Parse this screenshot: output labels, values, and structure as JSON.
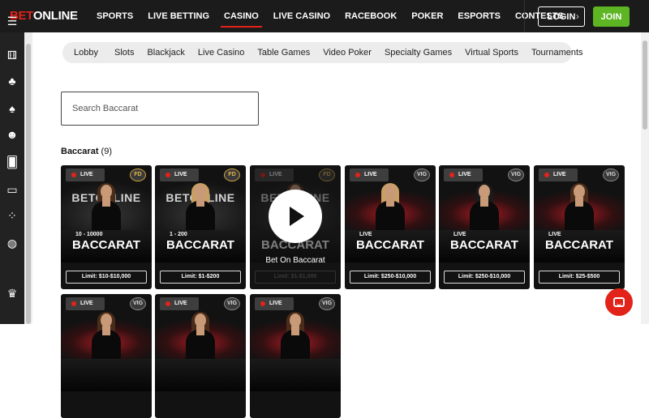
{
  "logo": {
    "part_red": "BET",
    "part_white": "ONLINE"
  },
  "nav": {
    "items": [
      "SPORTS",
      "LIVE BETTING",
      "CASINO",
      "LIVE CASINO",
      "RACEBOOK",
      "POKER",
      "ESPORTS",
      "CONTESTS"
    ],
    "active": "CASINO",
    "more_icon": "chevron-right-icon",
    "more_glyph": "›",
    "login_label": "LOGIN",
    "join_label": "JOIN"
  },
  "sidebar": {
    "icons": [
      {
        "name": "menu-icon",
        "glyph": "☰"
      },
      {
        "name": "dice-icon",
        "glyph": "⚅"
      },
      {
        "name": "cherries-icon",
        "glyph": "♣"
      },
      {
        "name": "spade-icon",
        "glyph": "♠"
      },
      {
        "name": "dealer-icon",
        "glyph": "☻"
      },
      {
        "name": "cards-icon",
        "glyph": "🂠"
      },
      {
        "name": "laptop-icon",
        "glyph": "▭"
      },
      {
        "name": "specialty-icon",
        "glyph": "⁘"
      },
      {
        "name": "basketball-icon",
        "glyph": "◍"
      },
      {
        "name": "trophy-icon",
        "glyph": "♛"
      }
    ]
  },
  "tabs": [
    "Lobby",
    "Slots",
    "Blackjack",
    "Live Casino",
    "Table Games",
    "Video Poker",
    "Specialty Games",
    "Virtual Sports",
    "Tournaments"
  ],
  "search": {
    "placeholder": "Search Baccarat"
  },
  "section": {
    "title": "Baccarat",
    "count": "(9)"
  },
  "games": [
    {
      "live": "LIVE",
      "provider": "FD",
      "brand": "BETONLINE",
      "range": "10 - 10000",
      "name": "BACCARAT",
      "limit": "Limit: $10-$10,000",
      "theme": "dark",
      "hair": "brown"
    },
    {
      "live": "LIVE",
      "provider": "FD",
      "brand": "BETONLINE",
      "range": "1 - 200",
      "name": "BACCARAT",
      "limit": "Limit: $1-$200",
      "theme": "dark",
      "hair": "blonde"
    },
    {
      "live": "LIVE",
      "provider": "FD",
      "brand": "BETONLINE",
      "range": "",
      "name": "BACCARAT",
      "limit": "Limit: $1-$1,000",
      "theme": "dark",
      "hair": "brown",
      "hover_title": "Bet On Baccarat"
    },
    {
      "live": "LIVE",
      "provider": "VIG",
      "brand": "",
      "range": "LIVE",
      "name": "BACCARAT",
      "limit": "Limit: $250-$10,000",
      "theme": "red",
      "hair": "blonde"
    },
    {
      "live": "LIVE",
      "provider": "VIG",
      "brand": "",
      "range": "LIVE",
      "name": "BACCARAT",
      "limit": "Limit: $250-$10,000",
      "theme": "red",
      "hair": "black"
    },
    {
      "live": "LIVE",
      "provider": "VIG",
      "brand": "",
      "range": "LIVE",
      "name": "BACCARAT",
      "limit": "Limit: $25-$500",
      "theme": "red",
      "hair": "brown"
    },
    {
      "live": "LIVE",
      "provider": "VIG",
      "brand": "",
      "range": "",
      "name": "",
      "limit": "",
      "theme": "red",
      "hair": "brown"
    },
    {
      "live": "LIVE",
      "provider": "VIG",
      "brand": "",
      "range": "",
      "name": "",
      "limit": "",
      "theme": "red",
      "hair": "brown"
    },
    {
      "live": "LIVE",
      "provider": "VIG",
      "brand": "",
      "range": "",
      "name": "",
      "limit": "",
      "theme": "red",
      "hair": "brown"
    }
  ],
  "chat": {
    "icon": "chat-icon"
  },
  "colors": {
    "accent_red": "#e2231a",
    "join_green": "#5db524",
    "topbar_bg": "#1b1b1b"
  }
}
